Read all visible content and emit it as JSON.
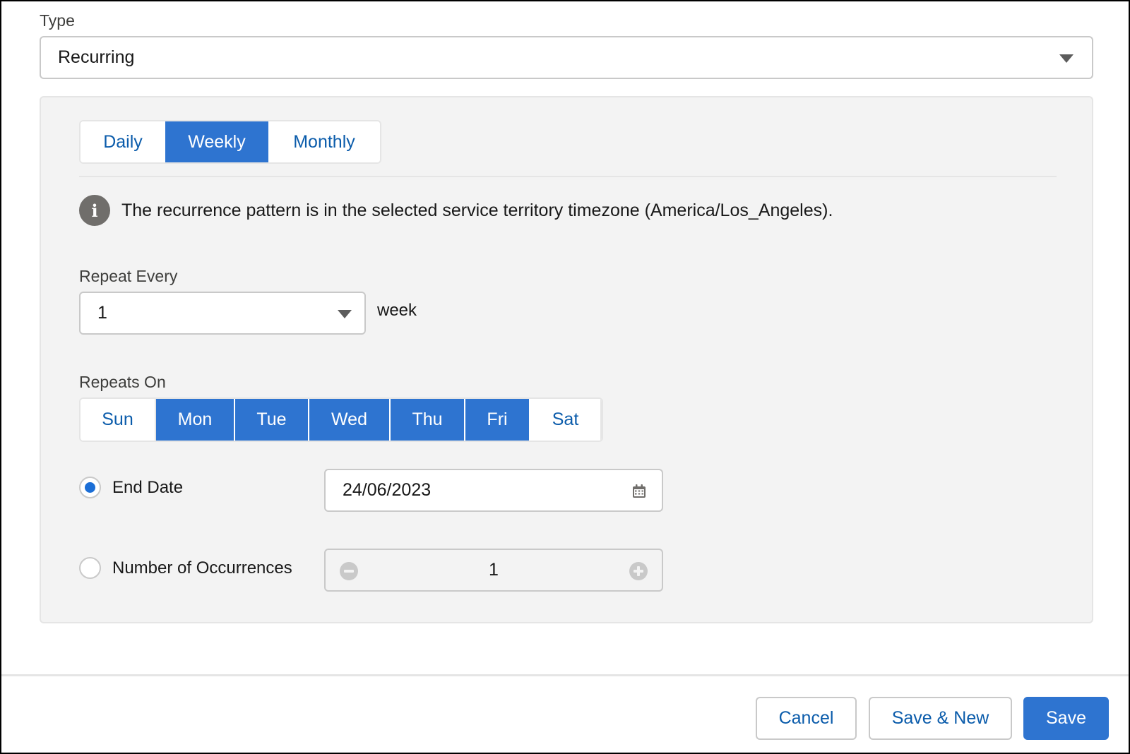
{
  "type_field": {
    "label": "Type",
    "value": "Recurring"
  },
  "frequency_tabs": [
    {
      "label": "Daily",
      "active": false
    },
    {
      "label": "Weekly",
      "active": true
    },
    {
      "label": "Monthly",
      "active": false
    }
  ],
  "info": {
    "icon": "info-icon",
    "message": "The recurrence pattern is in the selected service territory timezone (America/Los_Angeles)."
  },
  "repeat_every": {
    "label": "Repeat Every",
    "value": "1",
    "unit": "week"
  },
  "repeats_on": {
    "label": "Repeats On",
    "days": [
      {
        "label": "Sun",
        "selected": false
      },
      {
        "label": "Mon",
        "selected": true
      },
      {
        "label": "Tue",
        "selected": true
      },
      {
        "label": "Wed",
        "selected": true
      },
      {
        "label": "Thu",
        "selected": true
      },
      {
        "label": "Fri",
        "selected": true
      },
      {
        "label": "Sat",
        "selected": false
      }
    ]
  },
  "end_date": {
    "label": "End Date",
    "selected": true,
    "value": "24/06/2023",
    "icon": "calendar-icon"
  },
  "occurrences": {
    "label": "Number of Occurrences",
    "selected": false,
    "value": "1"
  },
  "footer": {
    "cancel_label": "Cancel",
    "save_new_label": "Save & New",
    "save_label": "Save"
  },
  "colors": {
    "brand_blue": "#2e74d0",
    "link_blue": "#0b5cab",
    "panel_bg": "#f3f3f3",
    "border": "#c9c9c9"
  }
}
